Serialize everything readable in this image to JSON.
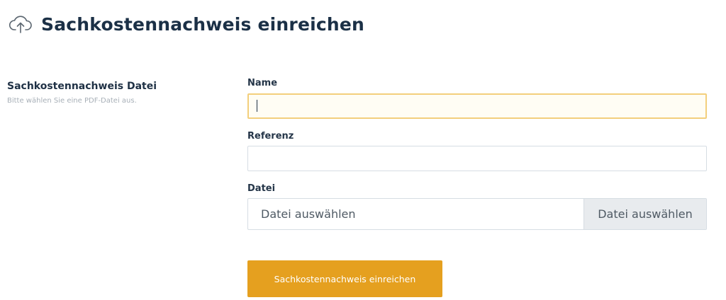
{
  "header": {
    "icon": "cloud-upload-icon",
    "title": "Sachkostennachweis einreichen"
  },
  "section": {
    "title": "Sachkostennachweis Datei",
    "description": "Bitte wählen Sie eine PDF-Datei aus."
  },
  "form": {
    "name": {
      "label": "Name",
      "value": ""
    },
    "reference": {
      "label": "Referenz",
      "value": ""
    },
    "file": {
      "label": "Datei",
      "placeholder": "Datei auswählen",
      "button_label": "Datei auswählen"
    },
    "submit_label": "Sachkostennachweis einreichen"
  },
  "colors": {
    "accent": "#e5a01f",
    "focus_border": "#f3cf7c",
    "title_text": "#1b3046"
  }
}
